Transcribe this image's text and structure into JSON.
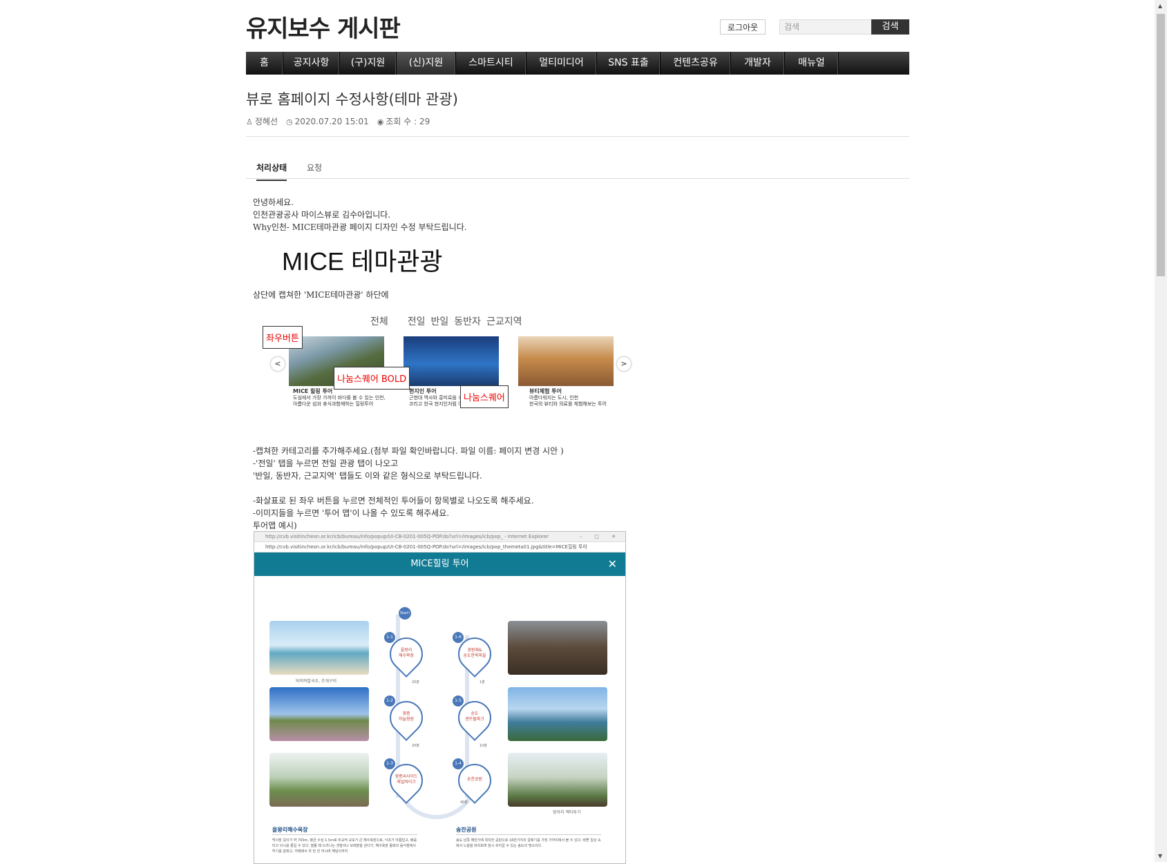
{
  "header": {
    "site_title": "유지보수 게시판",
    "logout_label": "로그아웃",
    "search_placeholder": "검색",
    "search_button": "검색"
  },
  "nav": {
    "items": [
      {
        "label": "홈"
      },
      {
        "label": "공지사항"
      },
      {
        "label": "(구)지원"
      },
      {
        "label": "(신)지원"
      },
      {
        "label": "스마트시티"
      },
      {
        "label": "멀티미디어"
      },
      {
        "label": "SNS 표출"
      },
      {
        "label": "컨텐츠공유"
      },
      {
        "label": "개발자"
      },
      {
        "label": "매뉴얼"
      }
    ]
  },
  "post": {
    "title": "뷰로 홈페이지 수정사항(테마 관광)",
    "author": "정혜선",
    "datetime": "2020.07.20 15:01",
    "views": "조회 수 : 29"
  },
  "tabs": [
    {
      "label": "처리상태"
    },
    {
      "label": "요청"
    }
  ],
  "body": {
    "intro": [
      "안녕하세요.",
      "인천관광공사 마이스뷰로 김수아입니다.",
      "Why인천- MICE테마관광 페이지 디자인 수정 부탁드립니다."
    ],
    "big_title": "MICE 테마관광",
    "caption": "상단에 캡쳐한 'MICE테마관광' 하단에",
    "categories": [
      "전체",
      "전일",
      "반일",
      "동반자",
      "근교지역"
    ],
    "thumbs": [
      {
        "title": "MICE 힐링 투어",
        "desc1": "도심에서 가장 가까이 바다를 볼 수 있는 인천,",
        "desc2": "아름다운 섬과 휴식과함께하는 힐링투어"
      },
      {
        "title": "현지인 투어",
        "desc1": "근현대 역사와 흥미로움 느낄 수 있는",
        "desc2": "코리고 한국 현지인처럼 여행하기"
      },
      {
        "title": "뷰티체험 투어",
        "desc1": "아름다워지는 도시, 인천",
        "desc2": "한국의 뷰티와 의료를 체험해보는 투어"
      }
    ],
    "annotations": [
      "좌우버튼",
      "나눔스퀘어 BOLD",
      "나눔스퀘어"
    ],
    "requests": [
      "-캡쳐한 카테고리를 추가해주세요.(첨부 파일 확인바랍니다. 파일 이름: 페이지 변경 시안 )",
      "-'전일' 탭을 누르면 전일 관광 탭이 나오고",
      "'반일, 동반자, 근교지역' 탭들도 이와 같은 형식으로 부탁드립니다.",
      "",
      "-화살표로 된 좌우 버튼을 누르면 전체적인 투어들이 항목별로 나오도록 해주세요.",
      "-이미지들을 누르면 '투어 맵'이 나올 수 있도록 해주세요.",
      "투어맵 예시)"
    ]
  },
  "popup": {
    "url1": "http://cvb.visitincheon.or.kr/icb/bureau/info/popup/UI-CB-0201-005Q-POP.do?url=/images/icb/pop_ - Internet Explorer",
    "url2": "http://cvb.visitincheon.or.kr/icb/bureau/info/popup/UI-CB-0201-005Q-POP.do?url=/images/icb/pop_themeta01.jpg&title=MICE힐링 투어",
    "title": "MICE힐링 투어",
    "start": "Start!",
    "left_caps": [
      "바지락칼국수, 조개구이"
    ],
    "right_caps": [
      "장아지 액티투기"
    ],
    "nodes": [
      {
        "num": "1-1",
        "label": "을왕리\n해수욕장"
      },
      {
        "num": "1-2",
        "label": "영종\n하늘정원"
      },
      {
        "num": "1-3",
        "label": "영종씨사이드\n레일바이크"
      },
      {
        "num": "1-4",
        "label": "송찬공원"
      },
      {
        "num": "1-5",
        "label": "송도\n센트럴파크"
      },
      {
        "num": "1-6",
        "label": "경원재&\n송도한옥마을"
      }
    ],
    "times": [
      "20분",
      "20분",
      "40분",
      "10분",
      "1분"
    ],
    "sections": [
      {
        "title": "을왕리해수욕장",
        "text": "백사장 길이가 약 700m, 평균 수심 1.5m로 비교적 규모가 큰 해수욕장으로, 낙조가 아름답고, 배를 타고 낚시를 즐길 수 있다. 썰물 때 드러나는 갯벌이나 모래밭을 걷다가, 해수욕장 둘레의 음식점에서 허기를 달래고, 카페에서 차 한 잔 하시며 해넘이까지"
      },
      {
        "title": "송찬공원",
        "text": "송도 남쪽 해안가에 위치한 공원으로 16만가지의 갈매기를 가장 가까이에서 볼 수 있다. 바쁜 일상 속에서 노을을 바라보며 잠시 쉬어갈 수 있는 송도의 명소이다."
      }
    ]
  }
}
